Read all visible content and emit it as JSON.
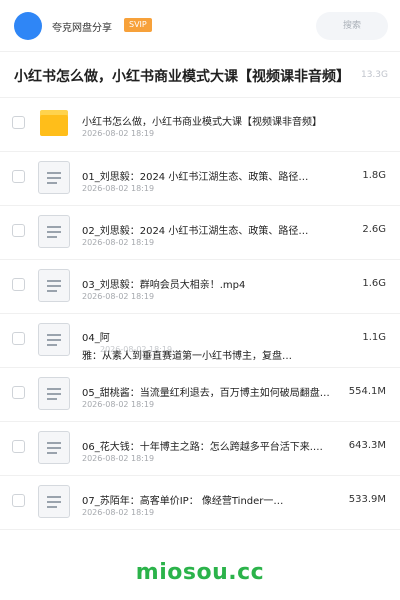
{
  "header": {
    "brand": "夸克网盘分享",
    "badge": "SVIP",
    "search_placeholder": "搜索"
  },
  "title": "小红书怎么做，小红书商业模式大课【视频课非音频】",
  "total_size": "13.3G",
  "items": [
    {
      "type": "folder",
      "name": "小红书怎么做，小红书商业模式大课【视频课非音频】",
      "date": "2026-08-02 18:19",
      "size": ""
    },
    {
      "type": "file",
      "name": "01_刘思毅：2024 小红书江湖生态、政策、路径…",
      "date": "2026-08-02 18:19",
      "size": "1.8G"
    },
    {
      "type": "file",
      "name": "02_刘思毅：2024 小红书江湖生态、政策、路径…",
      "date": "2026-08-02 18:19",
      "size": "2.6G"
    },
    {
      "type": "file",
      "name": "03_刘思毅：群响会员大相亲！.mp4",
      "date": "2026-08-02 18:19",
      "size": "1.6G"
    },
    {
      "type": "file",
      "name_line1": "04_阿",
      "name_line2": "雅：从素人到垂直赛道第一小红书博主，复盘…",
      "date": "2026-08-02 18:19",
      "size": "1.1G"
    },
    {
      "type": "file",
      "name": "05_甜桃酱：当流量红利退去，百万博主如何破局翻盘…",
      "date": "2026-08-02 18:19",
      "size": "554.1M"
    },
    {
      "type": "file",
      "name": "06_花大钱：十年博主之路：怎么跨越多平台活下来.…",
      "date": "2026-08-02 18:19",
      "size": "643.3M"
    },
    {
      "type": "file",
      "name": "07_苏陌年：高客单价IP： 像经营Tinder一…",
      "date": "2026-08-02 18:19",
      "size": "533.9M"
    }
  ],
  "watermark": "miosou.cc",
  "colors": {
    "accent": "#2f86f6",
    "badge": "#f7a13a",
    "folder": "#ffbe1a",
    "watermark": "#2bb34a"
  }
}
